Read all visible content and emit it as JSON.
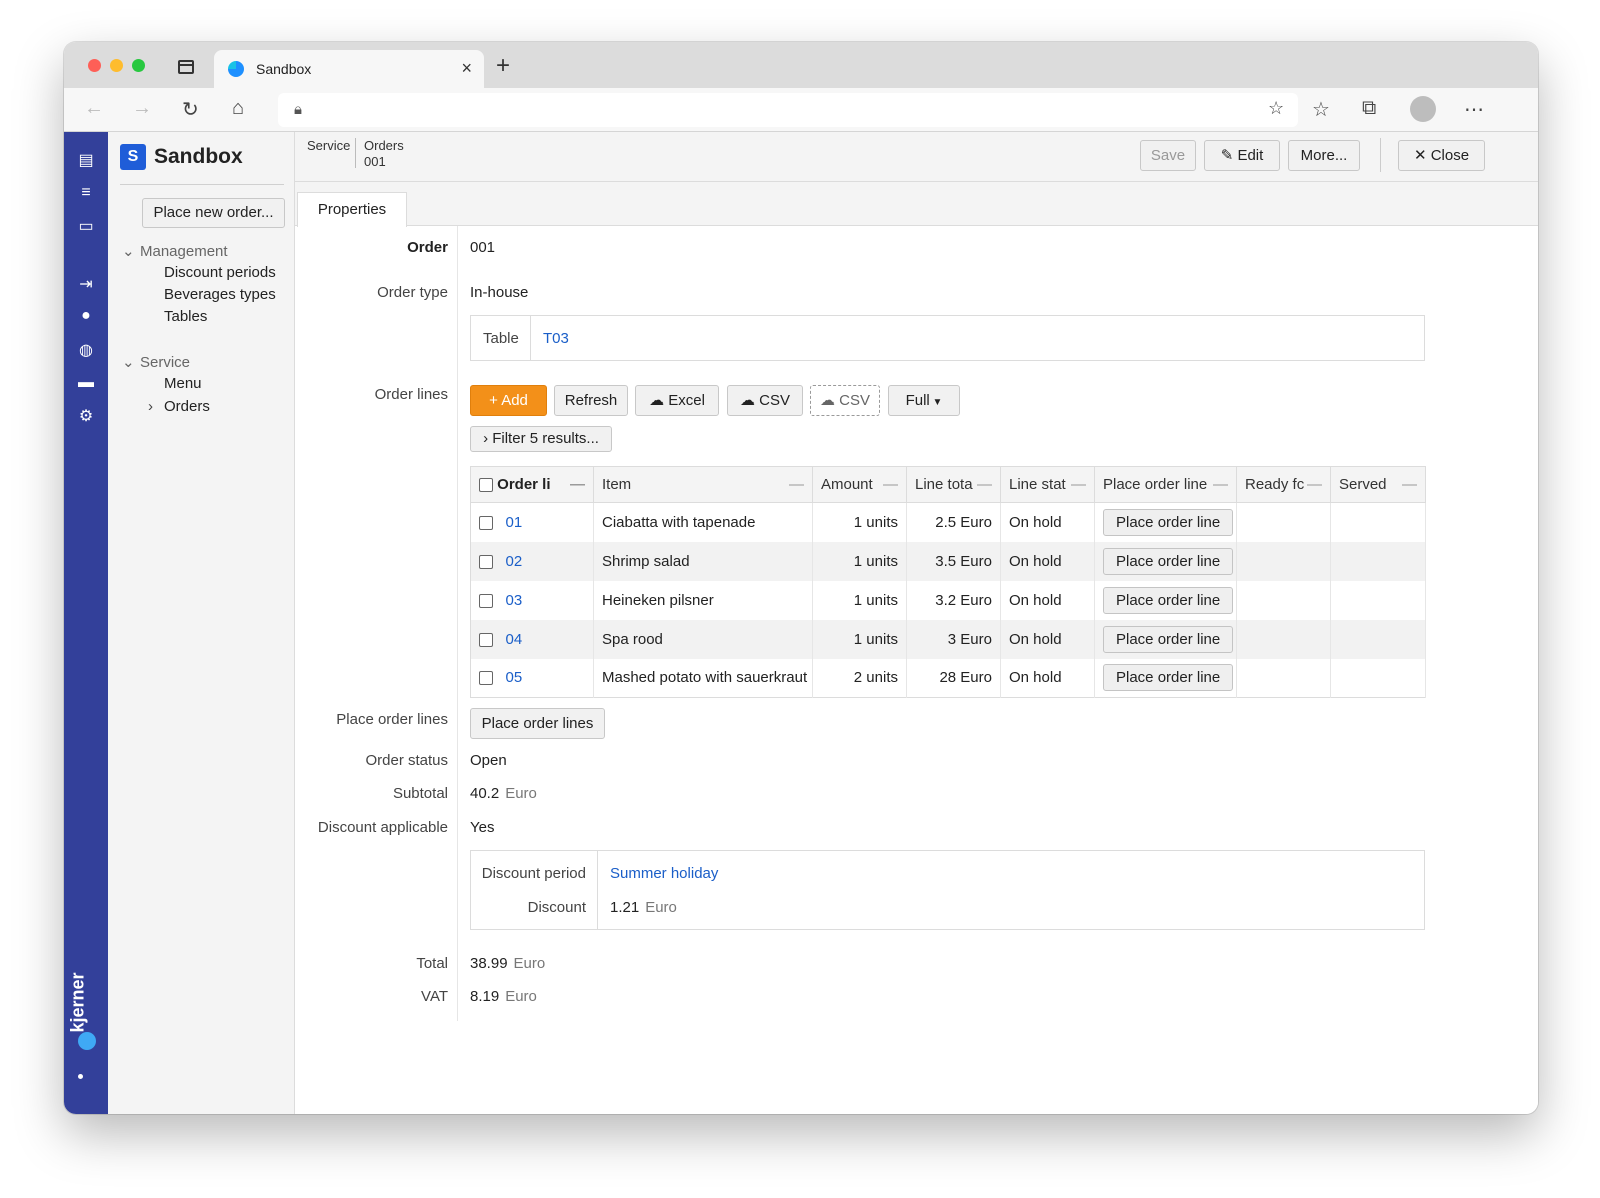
{
  "browser": {
    "tab_title": "Sandbox",
    "tab_close": "×",
    "new_tab": "+"
  },
  "sidebar": {
    "app_title": "Sandbox",
    "logo_letter": "S",
    "place_new_order": "Place new order...",
    "groups": [
      {
        "label": "Management",
        "items": [
          "Discount periods",
          "Beverages types",
          "Tables"
        ]
      },
      {
        "label": "Service",
        "items": [
          "Menu",
          "Orders"
        ]
      }
    ],
    "brand": "kjerner"
  },
  "toolbar": {
    "breadcrumb": [
      {
        "line1": "Service",
        "line2": ""
      },
      {
        "line1": "Orders",
        "line2": "001"
      }
    ],
    "save": "Save",
    "edit": "Edit",
    "more": "More...",
    "close": "Close"
  },
  "tabs": {
    "properties": "Properties"
  },
  "form": {
    "order_label": "Order",
    "order_value": "001",
    "order_type_label": "Order type",
    "order_type_value": "In-house",
    "table_label": "Table",
    "table_value": "T03",
    "order_lines_label": "Order lines",
    "buttons": {
      "add": "Add",
      "refresh": "Refresh",
      "excel": "Excel",
      "csv": "CSV",
      "csv2": "CSV",
      "full": "Full"
    },
    "filter": "Filter 5 results...",
    "place_order_lines_label": "Place order lines",
    "place_order_lines_button": "Place order lines",
    "order_status_label": "Order status",
    "order_status_value": "Open",
    "subtotal_label": "Subtotal",
    "subtotal_value": "40.2",
    "subtotal_unit": "Euro",
    "discount_applicable_label": "Discount applicable",
    "discount_applicable_value": "Yes",
    "discount_period_label": "Discount period",
    "discount_period_value": "Summer holiday",
    "discount_label": "Discount",
    "discount_value": "1.21",
    "discount_unit": "Euro",
    "total_label": "Total",
    "total_value": "38.99",
    "total_unit": "Euro",
    "vat_label": "VAT",
    "vat_value": "8.19",
    "vat_unit": "Euro"
  },
  "order_lines": {
    "columns": [
      "Order li",
      "Item",
      "Amount",
      "Line tota",
      "Line stat",
      "Place order line",
      "Ready fc",
      "Served"
    ],
    "rows": [
      {
        "id": "01",
        "item": "Ciabatta with tapenade",
        "amount": "1 units",
        "total": "2.5 Euro",
        "status": "On hold",
        "action": "Place order line",
        "ready": "",
        "served": ""
      },
      {
        "id": "02",
        "item": "Shrimp salad",
        "amount": "1 units",
        "total": "3.5 Euro",
        "status": "On hold",
        "action": "Place order line",
        "ready": "",
        "served": ""
      },
      {
        "id": "03",
        "item": "Heineken pilsner",
        "amount": "1 units",
        "total": "3.2 Euro",
        "status": "On hold",
        "action": "Place order line",
        "ready": "",
        "served": ""
      },
      {
        "id": "04",
        "item": "Spa rood",
        "amount": "1 units",
        "total": "3 Euro",
        "status": "On hold",
        "action": "Place order line",
        "ready": "",
        "served": ""
      },
      {
        "id": "05",
        "item": "Mashed potato with sauerkraut",
        "amount": "2 units",
        "total": "28 Euro",
        "status": "On hold",
        "action": "Place order line",
        "ready": "",
        "served": ""
      }
    ]
  }
}
